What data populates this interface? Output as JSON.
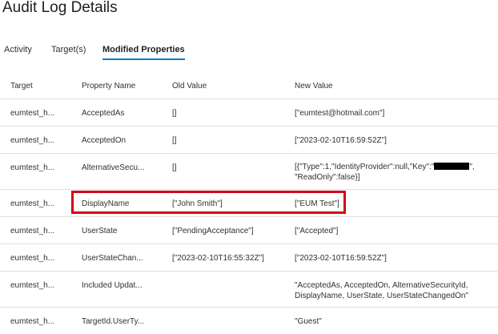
{
  "page": {
    "title": "Audit Log Details"
  },
  "tabs": [
    {
      "label": "Activity",
      "active": false
    },
    {
      "label": "Target(s)",
      "active": false
    },
    {
      "label": "Modified Properties",
      "active": true
    }
  ],
  "colors": {
    "accent": "#0078d4",
    "highlight_border": "#d0021b",
    "row_divider": "#e1dfdd"
  },
  "table": {
    "columns": [
      "Target",
      "Property Name",
      "Old Value",
      "New Value"
    ],
    "rows": [
      {
        "target": "eumtest_h...",
        "property": "AcceptedAs",
        "old": "[]",
        "new": "[\"eumtest@hotmail.com\"]"
      },
      {
        "target": "eumtest_h...",
        "property": "AcceptedOn",
        "old": "[]",
        "new": "[\"2023-02-10T16:59:52Z\"]"
      },
      {
        "target": "eumtest_h...",
        "property": "AlternativeSecu...",
        "old": "[]",
        "new_part1": "[{\"Type\":1,\"IdentityProvider\":null,\"Key\":\"",
        "new_part2": "\",",
        "new_line2": "\"ReadOnly\":false}]"
      },
      {
        "target": "eumtest_h...",
        "property": "DisplayName",
        "old": "[\"John Smith\"]",
        "new": "[\"EUM Test\"]",
        "highlighted": true
      },
      {
        "target": "eumtest_h...",
        "property": "UserState",
        "old": "[\"PendingAcceptance\"]",
        "new": "[\"Accepted\"]"
      },
      {
        "target": "eumtest_h...",
        "property": "UserStateChan...",
        "old": "[\"2023-02-10T16:55:32Z\"]",
        "new": "[\"2023-02-10T16:59:52Z\"]"
      },
      {
        "target": "eumtest_h...",
        "property": "Included Updat...",
        "old": "",
        "new": "\"AcceptedAs, AcceptedOn, AlternativeSecurityId, DisplayName, UserState, UserStateChangedOn\""
      },
      {
        "target": "eumtest_h...",
        "property": "TargetId.UserTy...",
        "old": "",
        "new": "\"Guest\""
      }
    ]
  }
}
